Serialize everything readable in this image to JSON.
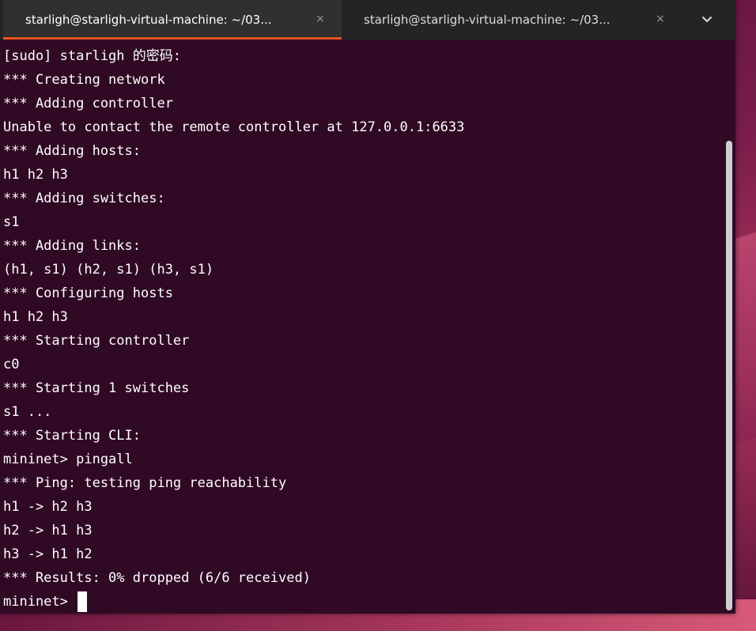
{
  "tabs": [
    {
      "label": "starligh@starligh-virtual-machine: ~/03...",
      "active": true
    },
    {
      "label": "starligh@starligh-virtual-machine: ~/03...",
      "active": false
    }
  ],
  "tab_close_symbol": "×",
  "icons": {
    "tab_close": "close-icon",
    "tab_menu": "chevron-down-icon"
  },
  "colors": {
    "terminal_bg": "#300a24",
    "tab_accent": "#e95420",
    "text": "#ffffff"
  },
  "terminal": {
    "lines": [
      "[sudo] starligh 的密码:",
      "*** Creating network",
      "*** Adding controller",
      "Unable to contact the remote controller at 127.0.0.1:6633",
      "*** Adding hosts:",
      "h1 h2 h3",
      "*** Adding switches:",
      "s1",
      "*** Adding links:",
      "(h1, s1) (h2, s1) (h3, s1)",
      "*** Configuring hosts",
      "h1 h2 h3",
      "*** Starting controller",
      "c0",
      "*** Starting 1 switches",
      "s1 ...",
      "*** Starting CLI:",
      "mininet> pingall",
      "*** Ping: testing ping reachability",
      "h1 -> h2 h3",
      "h2 -> h1 h3",
      "h3 -> h1 h2",
      "*** Results: 0% dropped (6/6 received)"
    ],
    "prompt": "mininet> "
  }
}
